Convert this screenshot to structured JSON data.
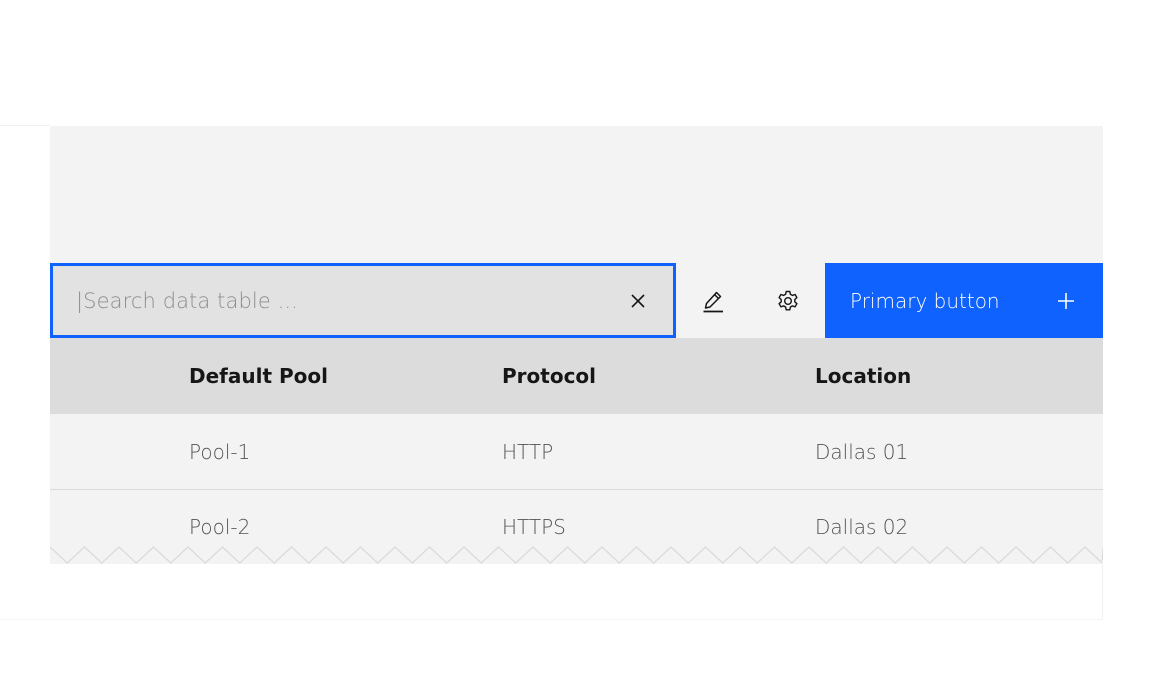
{
  "toolbar": {
    "search": {
      "value": "",
      "placeholder": "|Search data table ...",
      "clear_icon": "close-icon"
    },
    "edit_icon": "edit-icon",
    "settings_icon": "gear-icon",
    "primary_button": {
      "label": "Primary button",
      "icon": "add-icon"
    }
  },
  "table": {
    "headers": [
      "Default Pool",
      "Protocol",
      "Location"
    ],
    "rows": [
      [
        "Pool-1",
        "HTTP",
        "Dallas 01"
      ],
      [
        "Pool-2",
        "HTTPS",
        "Dallas 02"
      ]
    ]
  },
  "colors": {
    "accent": "#0f62fe",
    "panel_bg": "#f3f3f3",
    "header_bg": "#dcdcdc",
    "search_bg": "#e2e2e2"
  }
}
